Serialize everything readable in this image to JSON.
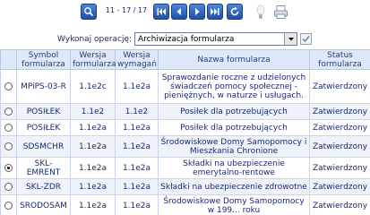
{
  "toolbar": {
    "counter": "11 - 17 / 17"
  },
  "operation": {
    "label": "Wykonaj operację:",
    "selected": "Archiwizacja formularza"
  },
  "table": {
    "headers": [
      "",
      "Symbol formularza",
      "Wersja formularza",
      "Wersja wymagań",
      "Nazwa formularza",
      "Status formularza"
    ],
    "rows": [
      {
        "selected": false,
        "symbol": "MPiPS-03-R",
        "wersja": "1.1e2c",
        "wymagan": "1.1e2a",
        "nazwa": "Sprawozdanie roczne z udzielonych świadczeń pomocy społecznej - pieniężnych, w naturze i usługach.",
        "status": "Zatwierdzony"
      },
      {
        "selected": false,
        "symbol": "POSIŁEK",
        "wersja": "1.1e2",
        "wymagan": "1.1e2",
        "nazwa": "Posiłek dla potrzebujących",
        "status": "Zatwierdzony"
      },
      {
        "selected": false,
        "symbol": "POSIŁEK",
        "wersja": "1.1e2a",
        "wymagan": "1.1e2a",
        "nazwa": "Posiłek dla potrzebujących",
        "status": "Zatwierdzony"
      },
      {
        "selected": false,
        "symbol": "SDSMCHR",
        "wersja": "1.1e2a",
        "wymagan": "1.1e2a",
        "nazwa": "Środowiskowe Domy Samopomocy i Mieszkania Chronione",
        "status": "Zatwierdzony"
      },
      {
        "selected": true,
        "symbol": "SKL-EMRENT",
        "wersja": "1.1e2a",
        "wymagan": "1.1e2a",
        "nazwa": "Składki na ubezpieczenie emerytalno-rentowe",
        "status": "Zatwierdzony"
      },
      {
        "selected": false,
        "symbol": "SKL-ZDR",
        "wersja": "1.1e2a",
        "wymagan": "1.1e2a",
        "nazwa": "Składki na ubezpieczenie zdrowotne",
        "status": "Zatwierdzony"
      },
      {
        "selected": false,
        "symbol": "SRODOSAM",
        "wersja": "1.1e2a",
        "wymagan": "1.1e2a",
        "nazwa": "Środowiskowe Domy Samopomocy w 199... roku",
        "status": "Zatwierdzony"
      }
    ]
  }
}
